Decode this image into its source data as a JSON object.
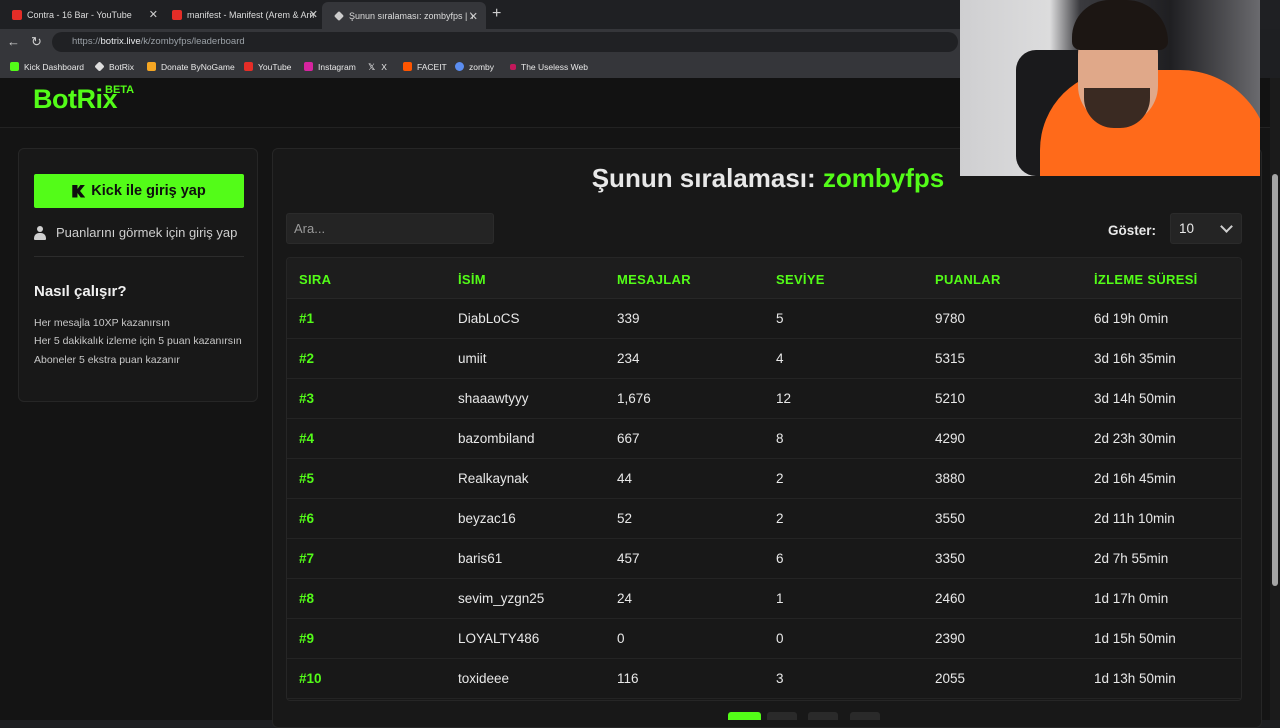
{
  "browser": {
    "tabs": [
      {
        "title": "Contra - 16 Bar - YouTube",
        "icon": "youtube-icon"
      },
      {
        "title": "manifest - Manifest (Arem & Arma",
        "icon": "youtube-icon"
      },
      {
        "title": "Şunun sıralaması: zombyfps | Yay",
        "icon": "botrix-icon"
      }
    ],
    "url_prefix": "https://",
    "url_host": "botrix.live",
    "url_path": "/k/zombyfps/leaderboard",
    "bookmarks": [
      {
        "label": "Kick Dashboard",
        "color": "#53fc18"
      },
      {
        "label": "BotRix",
        "color": "#dddddd"
      },
      {
        "label": "Donate ByNoGame",
        "color": "#f5a623"
      },
      {
        "label": "YouTube",
        "color": "#e52d27"
      },
      {
        "label": "Instagram",
        "color": "#d6249f"
      },
      {
        "label": "X",
        "color": "#ffffff"
      },
      {
        "label": "FACEIT",
        "color": "#ff5500"
      },
      {
        "label": "zomby",
        "color": "#5b8def"
      },
      {
        "label": "The Useless Web",
        "color": "#c2185b"
      }
    ]
  },
  "site": {
    "logo": "BotRix",
    "logo_badge": "BETA",
    "accent_color": "#53fc18"
  },
  "sidebar": {
    "login_button": "Kick ile giriş yap",
    "login_hint": "Puanlarını görmek için giriş yap",
    "how_title": "Nasıl çalışır?",
    "how_lines": [
      "Her mesajla 10XP kazanırsın",
      "Her 5 dakikalık izleme için 5 puan kazanırsın",
      "Aboneler 5 ekstra puan kazanır"
    ]
  },
  "leaderboard": {
    "heading_prefix": "Şunun sıralaması:",
    "channel": "zombyfps",
    "search_placeholder": "Ara...",
    "show_label": "Göster:",
    "show_value": "10",
    "columns": [
      "SIRA",
      "İSİM",
      "MESAJLAR",
      "SEVİYE",
      "PUANLAR",
      "İZLEME SÜRESİ"
    ],
    "rows": [
      [
        "#1",
        "DiabLoCS",
        "339",
        "5",
        "9780",
        "6d 19h 0min"
      ],
      [
        "#2",
        "umiit",
        "234",
        "4",
        "5315",
        "3d 16h 35min"
      ],
      [
        "#3",
        "shaaawtyyy",
        "1,676",
        "12",
        "5210",
        "3d 14h 50min"
      ],
      [
        "#4",
        "bazombiland",
        "667",
        "8",
        "4290",
        "2d 23h 30min"
      ],
      [
        "#5",
        "Realkaynak",
        "44",
        "2",
        "3880",
        "2d 16h 45min"
      ],
      [
        "#6",
        "beyzac16",
        "52",
        "2",
        "3550",
        "2d 11h 10min"
      ],
      [
        "#7",
        "baris61",
        "457",
        "6",
        "3350",
        "2d 7h 55min"
      ],
      [
        "#8",
        "sevim_yzgn25",
        "24",
        "1",
        "2460",
        "1d 17h 0min"
      ],
      [
        "#9",
        "LOYALTY486",
        "0",
        "0",
        "2390",
        "1d 15h 50min"
      ],
      [
        "#10",
        "toxideee",
        "116",
        "3",
        "2055",
        "1d 13h 50min"
      ]
    ]
  }
}
